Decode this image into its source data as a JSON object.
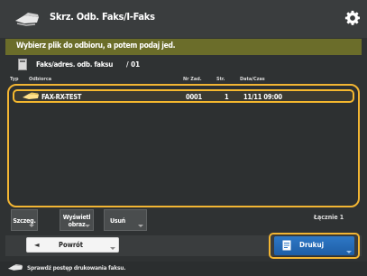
{
  "header": {
    "title": "Skrz. Odb. Faks/I-Faks"
  },
  "instruction": "Wybierz plik do odbioru, a potem podaj jed.",
  "address_book": {
    "label": "Faks/adres. odb. faksu",
    "count": "/ 01"
  },
  "columns": {
    "type": "Typ",
    "sender": "Odbiorca",
    "id": "Nr Zad.",
    "pages": "Str.",
    "datetime": "Data/Czas"
  },
  "rows": [
    {
      "type_icon": "fax-icon",
      "sender": "FAX-RX-TEST",
      "id": "0001",
      "pages": "1",
      "datetime": "11/11 09:00"
    }
  ],
  "function_buttons": {
    "details": "Szczeg.",
    "preview": "Wyświetl obraz",
    "delete": "Usuń"
  },
  "count_label": "Łącznie 1",
  "back_button": "Powrót",
  "send_button": "Drukuj",
  "footer_text": "Sprawdź postęp drukowania faksu."
}
